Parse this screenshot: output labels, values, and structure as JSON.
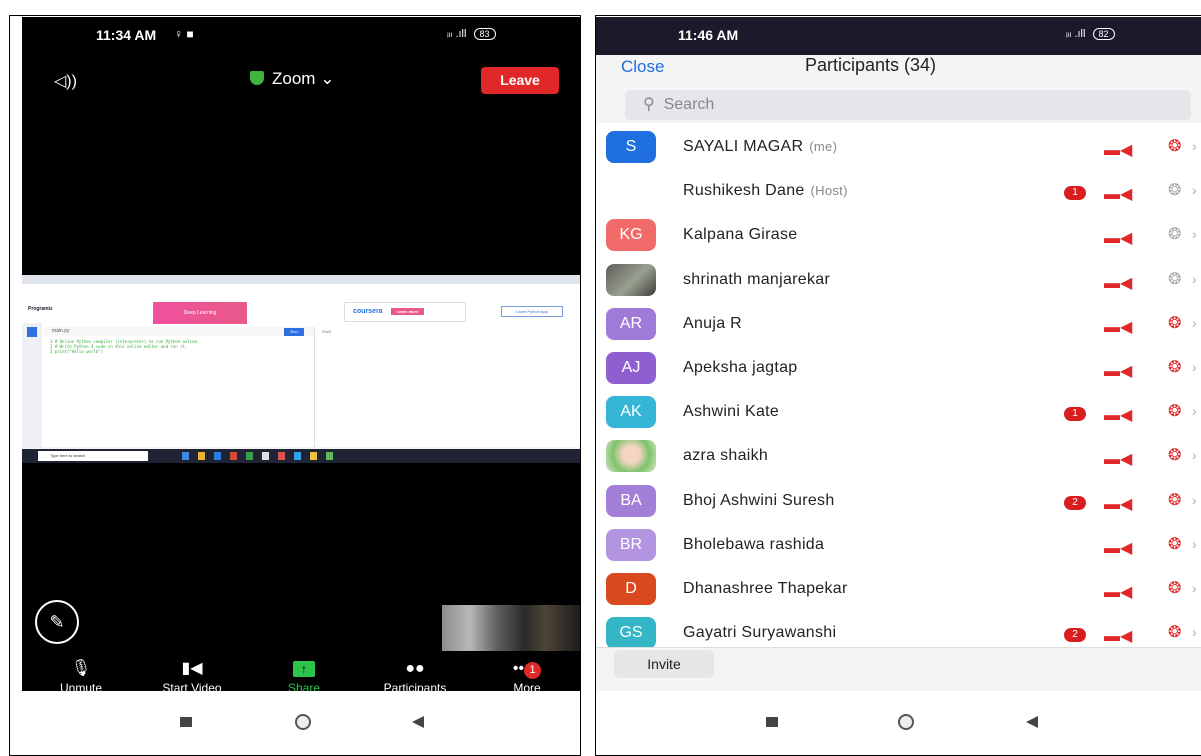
{
  "left_phone": {
    "status_time": "11:34 AM",
    "status_icons": "♀ ■",
    "signal": "ᵢₗₗ .ıll",
    "battery": "83",
    "speaker_icon": "speaker-icon",
    "meeting_title": "Zoom",
    "leave_label": "Leave",
    "shared_screen": {
      "logo": "Programiz",
      "ad_left": "Deep Learning",
      "ad_right": "coursera",
      "ad_right_cta": "Learn more",
      "learn_btn": "Learn Python App",
      "file_tab": "main.py",
      "run_label": "Run",
      "shell_label": "Shell",
      "code": [
        "1  # Online Python compiler (interpreter) to run Python online.",
        "2  # Write Python 3 code in this online editor and run it.",
        "3  print(\"Hello world\")"
      ],
      "taskbar_search": "Type here to search"
    },
    "toolbar": {
      "unmute": "Unmute",
      "start_video": "Start Video",
      "share": "Share",
      "participants": "Participants",
      "more": "More",
      "more_badge": "1"
    }
  },
  "right_phone": {
    "status_time": "11:46 AM",
    "signal": "ᵢₗₗ .ıll",
    "battery": "82",
    "close_label": "Close",
    "title": "Participants (34)",
    "search_placeholder": "Search",
    "participants": [
      {
        "initials": "S",
        "name": "SAYALI MAGAR",
        "tag": "(me)",
        "color": "#1f6fe0",
        "badge": "",
        "mic": "muted"
      },
      {
        "initials": "",
        "name": "Rushikesh Dane",
        "tag": "(Host)",
        "color": "#ffffff",
        "badge": "1",
        "mic": "on"
      },
      {
        "initials": "KG",
        "name": "Kalpana Girase",
        "tag": "",
        "color": "#f26b6b",
        "badge": "",
        "mic": "on"
      },
      {
        "initials": "",
        "name": "shrinath manjarekar",
        "tag": "",
        "color": "photo",
        "badge": "",
        "mic": "on"
      },
      {
        "initials": "AR",
        "name": "Anuja R",
        "tag": "",
        "color": "#a07ad8",
        "badge": "",
        "mic": "muted"
      },
      {
        "initials": "AJ",
        "name": "Apeksha jagtap",
        "tag": "",
        "color": "#8f5fd0",
        "badge": "",
        "mic": "muted"
      },
      {
        "initials": "AK",
        "name": "Ashwini Kate",
        "tag": "",
        "color": "#35b6d6",
        "badge": "1",
        "mic": "muted"
      },
      {
        "initials": "",
        "name": "azra shaikh",
        "tag": "",
        "color": "photo",
        "badge": "",
        "mic": "muted"
      },
      {
        "initials": "BA",
        "name": "Bhoj Ashwini Suresh",
        "tag": "",
        "color": "#a37fd8",
        "badge": "2",
        "mic": "muted"
      },
      {
        "initials": "BR",
        "name": "Bholebawa rashida",
        "tag": "",
        "color": "#b394e0",
        "badge": "",
        "mic": "muted"
      },
      {
        "initials": "D",
        "name": "Dhanashree Thapekar",
        "tag": "",
        "color": "#d84a1e",
        "badge": "",
        "mic": "muted"
      },
      {
        "initials": "GS",
        "name": "Gayatri Suryawanshi",
        "tag": "",
        "color": "#35b6c6",
        "badge": "2",
        "mic": "muted"
      }
    ],
    "invite_label": "Invite"
  }
}
